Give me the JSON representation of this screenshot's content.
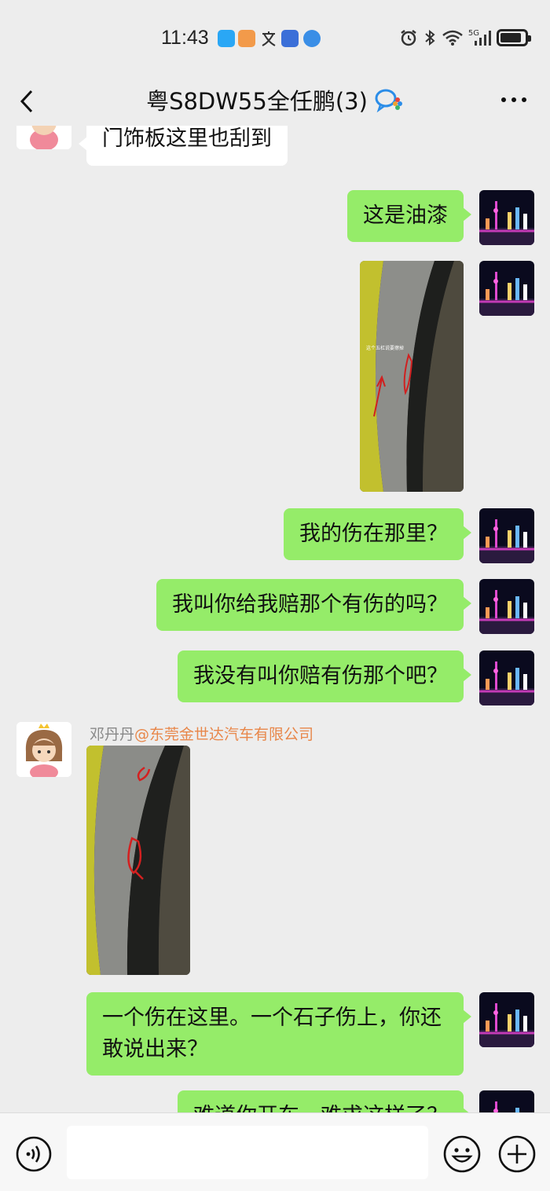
{
  "status": {
    "time": "11:43",
    "network": "5G"
  },
  "header": {
    "title": "粤S8DW55全任鹏(3)"
  },
  "messages": [
    {
      "side": "other",
      "type": "text",
      "text": "门饰板这里也刮到"
    },
    {
      "side": "me",
      "type": "text",
      "text": "这是油漆"
    },
    {
      "side": "me",
      "type": "image",
      "caption": "这个五杠说要擦掉"
    },
    {
      "side": "me",
      "type": "text",
      "text": "我的伤在那里？"
    },
    {
      "side": "me",
      "type": "text",
      "text": "我叫你给我赔那个有伤的吗？"
    },
    {
      "side": "me",
      "type": "text",
      "text": "我没有叫你赔有伤那个吧？"
    },
    {
      "side": "other",
      "type": "image",
      "sender": "邓丹丹",
      "mention": "@东莞金世达汽车有限公司"
    },
    {
      "side": "me",
      "type": "text",
      "text": "一个伤在这里。一个石子伤上，你还敢说出来？"
    },
    {
      "side": "me",
      "type": "text",
      "text": "难道你开车，难求这样了？"
    }
  ],
  "colors": {
    "background": "#ededed",
    "my_bubble": "#95ec69",
    "other_bubble": "#ffffff",
    "mention": "#e8874a"
  }
}
